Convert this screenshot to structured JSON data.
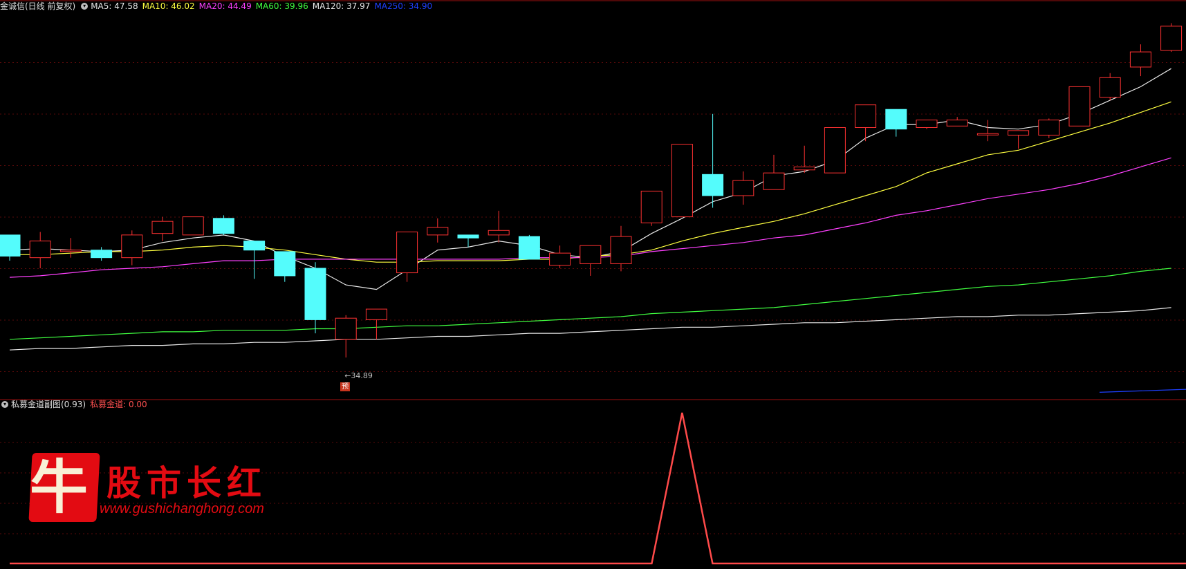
{
  "main_header": {
    "title": "金诚信(日线 前复权)",
    "ma": [
      {
        "label": "MA5: 47.58",
        "color": "#e8e8e8"
      },
      {
        "label": "MA10: 46.02",
        "color": "#ffff40"
      },
      {
        "label": "MA20: 44.49",
        "color": "#ff40ff"
      },
      {
        "label": "MA60: 39.96",
        "color": "#40ff40"
      },
      {
        "label": "MA120: 37.97",
        "color": "#e8e8e8"
      },
      {
        "label": "MA250: 34.90",
        "color": "#1e40ff"
      }
    ]
  },
  "sub_header": {
    "title": "私募金道副图(0.93)",
    "indicator_label": "私募金道: 0.00",
    "indicator_color": "#ff5050"
  },
  "low_marker": {
    "label": "←34.89",
    "badge": "预"
  },
  "logo": {
    "glyph": "牛",
    "text": "股市长红",
    "url": "www.gushichanghong.com"
  },
  "colors": {
    "up": "#ff3232",
    "down": "#54fcfc",
    "grid": "#5a0a0a",
    "frame": "#a01010"
  },
  "chart_data": {
    "type": "candlestick",
    "note_units": "price in CNY",
    "candles": [
      {
        "o": 44.0,
        "h": 44.0,
        "l": 42.3,
        "c": 42.6
      },
      {
        "o": 42.5,
        "h": 44.2,
        "l": 41.8,
        "c": 43.6
      },
      {
        "o": 43.0,
        "h": 43.8,
        "l": 42.5,
        "c": 43.0
      },
      {
        "o": 43.0,
        "h": 43.2,
        "l": 42.3,
        "c": 42.5
      },
      {
        "o": 42.5,
        "h": 44.3,
        "l": 42.0,
        "c": 44.0
      },
      {
        "o": 44.1,
        "h": 45.2,
        "l": 43.6,
        "c": 44.9
      },
      {
        "o": 44.0,
        "h": 45.2,
        "l": 44.0,
        "c": 45.2
      },
      {
        "o": 45.1,
        "h": 45.3,
        "l": 44.0,
        "c": 44.1
      },
      {
        "o": 43.6,
        "h": 43.6,
        "l": 41.1,
        "c": 43.0
      },
      {
        "o": 42.9,
        "h": 42.9,
        "l": 40.9,
        "c": 41.3
      },
      {
        "o": 41.8,
        "h": 42.2,
        "l": 37.5,
        "c": 38.4
      },
      {
        "o": 37.1,
        "h": 38.7,
        "l": 35.9,
        "c": 38.5
      },
      {
        "o": 38.4,
        "h": 38.7,
        "l": 37.1,
        "c": 39.1
      },
      {
        "o": 41.5,
        "h": 42.8,
        "l": 40.9,
        "c": 44.2
      },
      {
        "o": 44.0,
        "h": 45.1,
        "l": 43.5,
        "c": 44.5
      },
      {
        "o": 44.0,
        "h": 44.0,
        "l": 43.2,
        "c": 43.8
      },
      {
        "o": 44.0,
        "h": 45.6,
        "l": 43.5,
        "c": 44.3
      },
      {
        "o": 43.9,
        "h": 44.0,
        "l": 42.6,
        "c": 42.4
      },
      {
        "o": 42.0,
        "h": 43.3,
        "l": 41.8,
        "c": 42.8
      },
      {
        "o": 42.1,
        "h": 42.6,
        "l": 41.3,
        "c": 43.3
      },
      {
        "o": 42.1,
        "h": 44.6,
        "l": 41.6,
        "c": 43.9
      },
      {
        "o": 44.8,
        "h": 46.8,
        "l": 44.6,
        "c": 46.9
      },
      {
        "o": 45.2,
        "h": 49.7,
        "l": 45.2,
        "c": 50.0
      },
      {
        "o": 48.0,
        "h": 52.0,
        "l": 45.8,
        "c": 46.6
      },
      {
        "o": 46.6,
        "h": 48.2,
        "l": 46.0,
        "c": 47.6
      },
      {
        "o": 47.0,
        "h": 49.3,
        "l": 47.6,
        "c": 48.1
      },
      {
        "o": 48.3,
        "h": 49.9,
        "l": 48.1,
        "c": 48.5
      },
      {
        "o": 48.1,
        "h": 48.7,
        "l": 48.5,
        "c": 51.1
      },
      {
        "o": 51.1,
        "h": 52.4,
        "l": 50.2,
        "c": 52.6
      },
      {
        "o": 52.3,
        "h": 52.3,
        "l": 50.5,
        "c": 51.0
      },
      {
        "o": 51.1,
        "h": 51.4,
        "l": 51.0,
        "c": 51.6
      },
      {
        "o": 51.2,
        "h": 51.8,
        "l": 51.4,
        "c": 51.6
      },
      {
        "o": 50.7,
        "h": 51.6,
        "l": 50.2,
        "c": 50.7
      },
      {
        "o": 50.6,
        "h": 50.6,
        "l": 49.7,
        "c": 50.9
      },
      {
        "o": 50.6,
        "h": 51.7,
        "l": 50.4,
        "c": 51.6
      },
      {
        "o": 51.2,
        "h": 53.8,
        "l": 51.2,
        "c": 53.8
      },
      {
        "o": 53.1,
        "h": 54.7,
        "l": 52.9,
        "c": 54.4
      },
      {
        "o": 55.1,
        "h": 56.6,
        "l": 54.5,
        "c": 56.1
      },
      {
        "o": 56.2,
        "h": 58.0,
        "l": 56.1,
        "c": 57.8
      }
    ],
    "ma": {
      "MA5": [
        43.0,
        43.1,
        43.0,
        42.9,
        43.0,
        43.5,
        43.8,
        44.0,
        43.6,
        42.6,
        41.8,
        40.7,
        40.4,
        41.7,
        43.0,
        43.2,
        43.6,
        43.3,
        42.7,
        42.5,
        42.9,
        44.1,
        45.1,
        46.2,
        46.8,
        47.9,
        48.2,
        48.9,
        50.4,
        51.3,
        51.3,
        51.6,
        51.1,
        51.0,
        51.3,
        52.0,
        52.9,
        53.8,
        55.0
      ],
      "MA10": [
        42.7,
        42.7,
        42.8,
        42.9,
        42.9,
        43.0,
        43.2,
        43.3,
        43.2,
        43.0,
        42.7,
        42.4,
        42.2,
        42.2,
        42.3,
        42.3,
        42.3,
        42.4,
        42.4,
        42.6,
        42.7,
        43.0,
        43.6,
        44.1,
        44.5,
        44.9,
        45.4,
        46.0,
        46.6,
        47.2,
        48.1,
        48.7,
        49.3,
        49.6,
        50.2,
        50.8,
        51.4,
        52.1,
        52.8
      ],
      "MA20": [
        41.2,
        41.3,
        41.5,
        41.7,
        41.8,
        41.9,
        42.1,
        42.3,
        42.3,
        42.4,
        42.4,
        42.4,
        42.4,
        42.4,
        42.4,
        42.4,
        42.4,
        42.5,
        42.5,
        42.5,
        42.6,
        42.9,
        43.1,
        43.3,
        43.5,
        43.8,
        44.0,
        44.4,
        44.8,
        45.3,
        45.6,
        46.0,
        46.4,
        46.7,
        47.0,
        47.4,
        47.9,
        48.5,
        49.1
      ],
      "MA60": [
        37.1,
        37.2,
        37.3,
        37.4,
        37.5,
        37.6,
        37.6,
        37.7,
        37.7,
        37.7,
        37.8,
        37.8,
        37.9,
        38.0,
        38.0,
        38.1,
        38.2,
        38.3,
        38.4,
        38.5,
        38.6,
        38.8,
        38.9,
        39.0,
        39.1,
        39.2,
        39.4,
        39.6,
        39.8,
        40.0,
        40.2,
        40.4,
        40.6,
        40.7,
        40.9,
        41.1,
        41.3,
        41.6,
        41.8
      ],
      "MA120": [
        36.4,
        36.5,
        36.5,
        36.6,
        36.7,
        36.7,
        36.8,
        36.8,
        36.9,
        36.9,
        37.0,
        37.1,
        37.1,
        37.2,
        37.3,
        37.3,
        37.4,
        37.5,
        37.5,
        37.6,
        37.7,
        37.8,
        37.9,
        37.9,
        38.0,
        38.1,
        38.2,
        38.2,
        38.3,
        38.4,
        38.5,
        38.6,
        38.6,
        38.7,
        38.7,
        38.8,
        38.9,
        39.0,
        39.2
      ],
      "MA250": [
        null,
        null,
        null,
        null,
        null,
        null,
        null,
        null,
        null,
        null,
        null,
        null,
        null,
        null,
        null,
        null,
        null,
        null,
        null,
        null,
        null,
        null,
        null,
        null,
        null,
        null,
        null,
        null,
        null,
        null,
        null,
        null,
        null,
        null,
        null,
        null,
        33.6,
        33.7,
        33.8
      ]
    },
    "ma_colors": {
      "MA5": "#e8e8e8",
      "MA10": "#ffff40",
      "MA20": "#ff40ff",
      "MA60": "#40ff40",
      "MA120": "#e8e8e8",
      "MA250": "#1e40ff"
    },
    "price_range": [
      33.3,
      58.8
    ],
    "indicator": {
      "name": "私募金道",
      "values": [
        0,
        0,
        0,
        0,
        0,
        0,
        0,
        0,
        0,
        0,
        0,
        0,
        0,
        0,
        0,
        0,
        0,
        0,
        0,
        0,
        0,
        0,
        1,
        0,
        0,
        0,
        0,
        0,
        0,
        0,
        0,
        0,
        0,
        0,
        0,
        0,
        0,
        0,
        0
      ],
      "range": [
        0,
        1
      ]
    },
    "low_marker_value": 34.89,
    "low_marker_index": 11
  }
}
